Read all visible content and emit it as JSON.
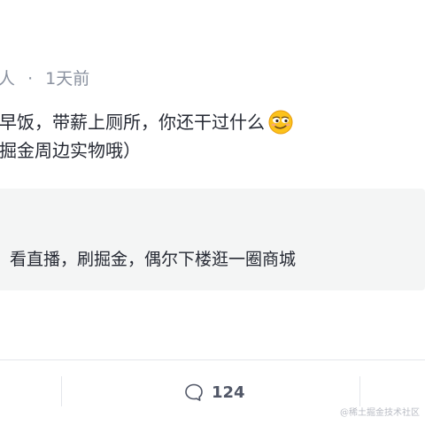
{
  "post": {
    "author_fragment": "人",
    "separator": "·",
    "time": "1天前",
    "content_line1": "早饭，带薪上厕所，你还干过什么",
    "content_emoji": "smirk-emoji",
    "content_line2": "掘金周边实物哦）",
    "quote_text": "，看直播，刷掘金，偶尔下楼逛一圈商城"
  },
  "actions": {
    "comment_icon": "comment-bubble-icon",
    "comment_count": "124"
  },
  "watermark": "@稀土掘金技术社区",
  "colors": {
    "meta_text": "#8a919f",
    "body_text": "#252933",
    "quote_bg": "#f4f5f5",
    "divider": "#e4e6eb"
  }
}
